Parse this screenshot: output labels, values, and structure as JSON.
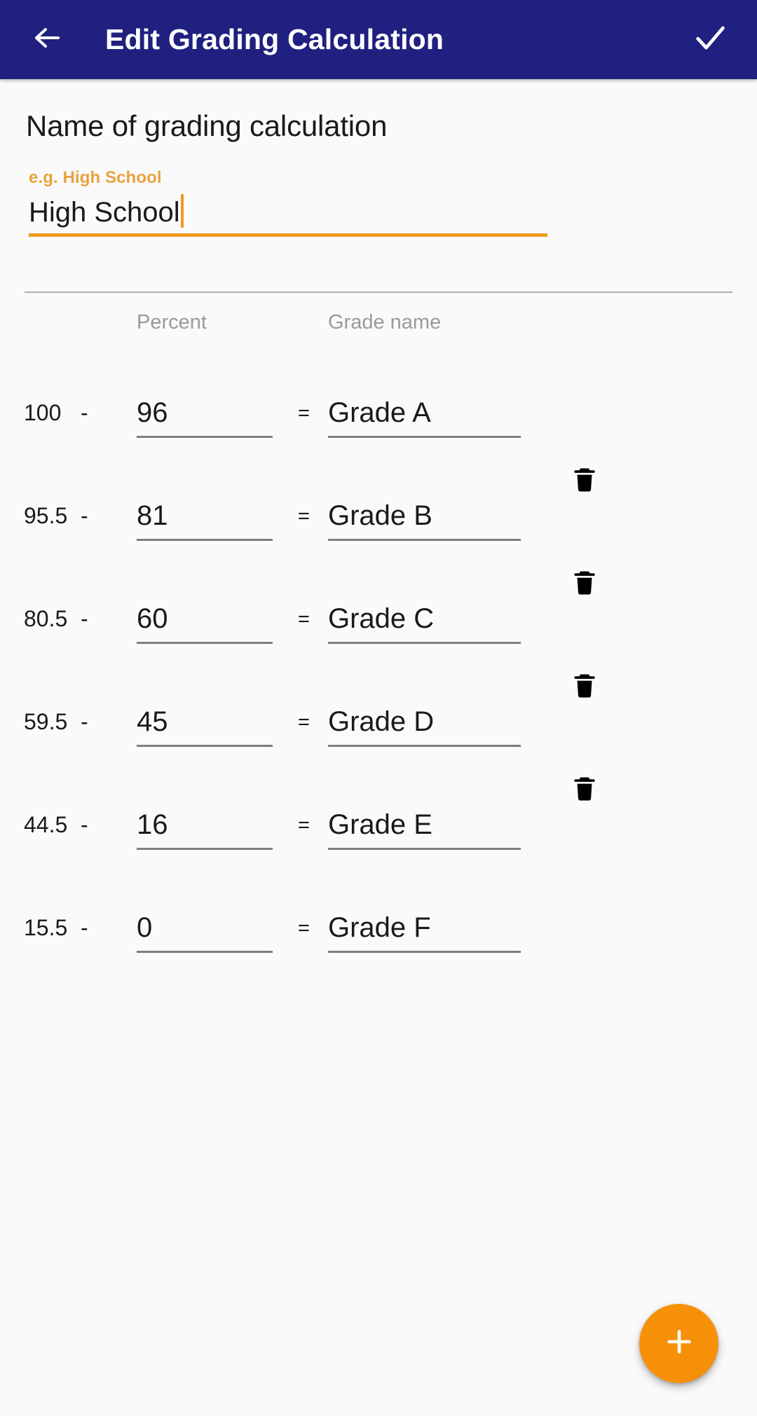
{
  "appbar": {
    "back_icon": "arrow-left-icon",
    "title": "Edit Grading Calculation",
    "done_icon": "check-icon",
    "background_color": "#202080",
    "foreground_color": "#ffffff"
  },
  "form": {
    "section_title": "Name of grading calculation",
    "name_field": {
      "label": "e.g. High School",
      "value": "High School",
      "placeholder": "e.g. High School",
      "accent_color": "#ef9a21",
      "focused": true
    }
  },
  "table": {
    "headers": {
      "low": "",
      "percent": "Percent",
      "equals": "",
      "grade_name": "Grade name"
    },
    "dash": "-",
    "equals": "=",
    "delete_icon": "trash-icon",
    "rows": [
      {
        "low": "100",
        "percent": "96",
        "grade_name": "Grade A",
        "deletable": false
      },
      {
        "low": "95.5",
        "percent": "81",
        "grade_name": "Grade B",
        "deletable": true
      },
      {
        "low": "80.5",
        "percent": "60",
        "grade_name": "Grade C",
        "deletable": true
      },
      {
        "low": "59.5",
        "percent": "45",
        "grade_name": "Grade D",
        "deletable": true
      },
      {
        "low": "44.5",
        "percent": "16",
        "grade_name": "Grade E",
        "deletable": true
      },
      {
        "low": "15.5",
        "percent": "0",
        "grade_name": "Grade F",
        "deletable": false
      }
    ]
  },
  "fab": {
    "icon": "plus-icon",
    "label": "+",
    "color": "#f79009"
  }
}
